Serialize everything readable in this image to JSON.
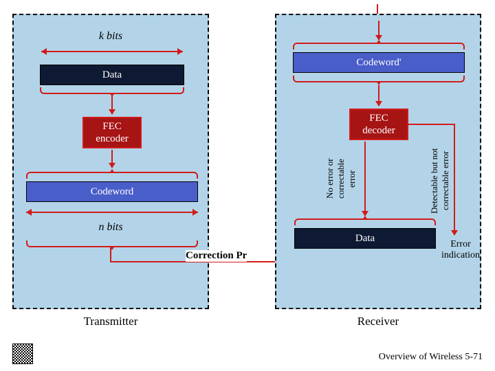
{
  "transmitter": {
    "label": "Transmitter",
    "k_bits": "k bits",
    "data": "Data",
    "encoder": "FEC\nencoder",
    "codeword": "Codeword",
    "n_bits": "n bits"
  },
  "receiver": {
    "label": "Receiver",
    "codeword": "Codeword'",
    "decoder": "FEC\ndecoder",
    "data": "Data",
    "path_ok": "No error or\ncorrectable\nerror",
    "path_detect": "Detectable but not\ncorrectable error",
    "error_indication": "Error\nindication"
  },
  "title_fragment": "Correction Pr",
  "footer": "Overview of Wireless 5-71"
}
